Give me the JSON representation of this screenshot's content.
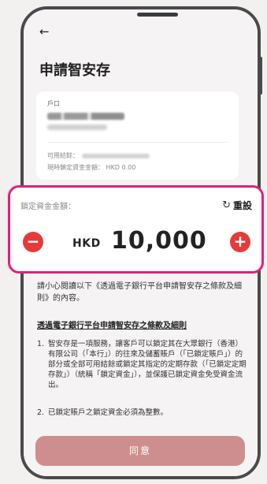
{
  "header": {
    "back_icon": "←",
    "title": "申請智安存"
  },
  "account_card": {
    "account_label": "戶口",
    "available_label": "可用結餘：",
    "current_locked_label": "現時鎖定資金金額：",
    "current_locked_value": "HKD 0.00"
  },
  "amount_card": {
    "label": "鎖定資金金額：",
    "reset_icon": "↻",
    "reset_label": "重設",
    "minus_icon": "−",
    "plus_icon": "+",
    "currency": "HKD",
    "amount": "10,000"
  },
  "terms": {
    "intro": "請小心閱讀以下《透過電子銀行平台申請智安存之條款及細則》的內容。",
    "title": "透過電子銀行平台申請智安存之條款及細則",
    "items": [
      {
        "num": "1.",
        "text": "智安存是一項服務，讓客戶可以鎖定其在大眾銀行（香港）有限公司（「本行」）的往來及儲蓄賬戶（「已鎖定賬戶」）的部分或全部可用結餘或鎖定其指定的定期存款（「已鎖定定期存款」）（統稱「鎖定資金」），並保護已鎖定資金免受資金流出。"
      },
      {
        "num": "2.",
        "text": "已鎖定賬戶之鎖定資金必須為整數。"
      }
    ]
  },
  "agree_button": {
    "label": "同意"
  },
  "colors": {
    "highlight_border": "#e2207a",
    "stepper_red": "#e63a3a",
    "agree_button": "#cf8e8e"
  }
}
